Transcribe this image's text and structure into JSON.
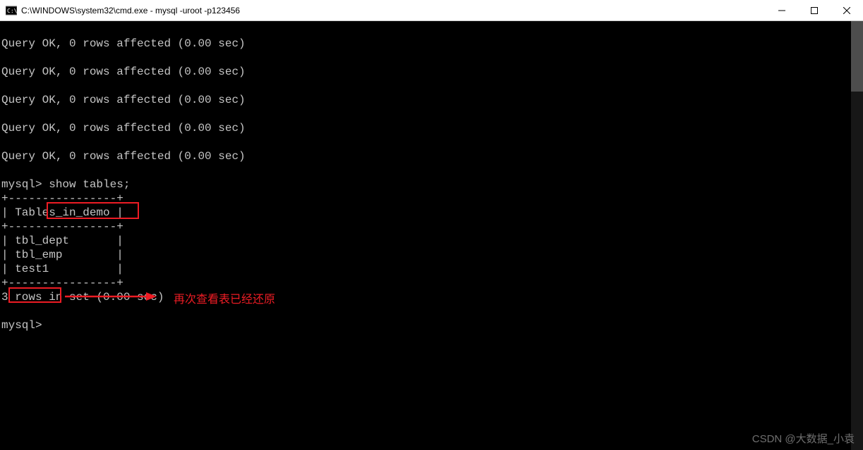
{
  "window": {
    "title": "C:\\WINDOWS\\system32\\cmd.exe - mysql  -uroot -p123456"
  },
  "terminal": {
    "lines": [
      "",
      "Query OK, 0 rows affected (0.00 sec)",
      "",
      "Query OK, 0 rows affected (0.00 sec)",
      "",
      "Query OK, 0 rows affected (0.00 sec)",
      "",
      "Query OK, 0 rows affected (0.00 sec)",
      "",
      "Query OK, 0 rows affected (0.00 sec)",
      "",
      "mysql> show tables;",
      "+----------------+",
      "| Tables_in_demo |",
      "+----------------+",
      "| tbl_dept       |",
      "| tbl_emp        |",
      "| test1          |",
      "+----------------+",
      "3 rows in set (0.00 sec)",
      "",
      "mysql>"
    ],
    "prompt1": "mysql> ",
    "command1": "show tables;",
    "table_header_sep": "+----------------+",
    "table_header": "| Tables_in_demo |",
    "table_rows": [
      "| tbl_dept       |",
      "| tbl_emp        |",
      "| test1          |"
    ],
    "result_summary": "3 rows in set (0.00 sec)",
    "prompt2": "mysql>"
  },
  "annotation": {
    "text": "再次查看表已经还原"
  },
  "watermark": {
    "text": "CSDN @大数据_小袁"
  },
  "colors": {
    "highlight_red": "#ed1c24",
    "terminal_fg": "#c5c5c5",
    "terminal_bg": "#000000"
  }
}
